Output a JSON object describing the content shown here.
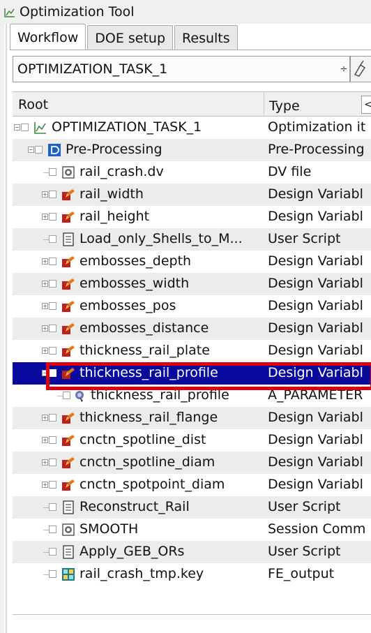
{
  "window": {
    "title": "Optimization Tool",
    "icon": "optimization-app-icon"
  },
  "tabs": [
    {
      "label": "Workflow",
      "active": true
    },
    {
      "label": "DOE setup",
      "active": false
    },
    {
      "label": "Results",
      "active": false
    }
  ],
  "task_select": {
    "value": "OPTIMIZATION_TASK_1",
    "spinner": "÷",
    "tool_icon": "brush-icon"
  },
  "columns": {
    "root": "Root",
    "type": "Type",
    "button": "<"
  },
  "tree": [
    {
      "name": "OPTIMIZATION_TASK_1",
      "type": "Optimization it",
      "icon": "optimization-task-icon",
      "level": 0
    },
    {
      "name": "Pre-Processing",
      "type": "Pre-Processing",
      "icon": "preprocessing-icon",
      "level": 1
    },
    {
      "name": "rail_crash.dv",
      "type": "DV file",
      "icon": "dv-file-icon",
      "level": 2
    },
    {
      "name": "rail_width",
      "type": "Design Variabl",
      "icon": "design-variable-icon",
      "level": 2
    },
    {
      "name": "rail_height",
      "type": "Design Variabl",
      "icon": "design-variable-icon",
      "level": 2
    },
    {
      "name": "Load_only_Shells_to_M...",
      "type": "User Script",
      "icon": "user-script-icon",
      "level": 2
    },
    {
      "name": "embosses_depth",
      "type": "Design Variabl",
      "icon": "design-variable-icon",
      "level": 2
    },
    {
      "name": "embosses_width",
      "type": "Design Variabl",
      "icon": "design-variable-icon",
      "level": 2
    },
    {
      "name": "embosses_pos",
      "type": "Design Variabl",
      "icon": "design-variable-icon",
      "level": 2
    },
    {
      "name": "embosses_distance",
      "type": "Design Variabl",
      "icon": "design-variable-icon",
      "level": 2
    },
    {
      "name": "thickness_rail_plate",
      "type": "Design Variabl",
      "icon": "design-variable-icon",
      "level": 2
    },
    {
      "name": "thickness_rail_profile",
      "type": "Design Variabl",
      "icon": "design-variable-icon",
      "level": 2,
      "selected": true
    },
    {
      "name": "thickness_rail_profile",
      "type": "A_PARAMETER",
      "icon": "parameter-icon",
      "level": 3,
      "highlighted": true
    },
    {
      "name": "thickness_rail_flange",
      "type": "Design Variabl",
      "icon": "design-variable-icon",
      "level": 2
    },
    {
      "name": "cnctn_spotline_dist",
      "type": "Design Variabl",
      "icon": "design-variable-icon",
      "level": 2
    },
    {
      "name": "cnctn_spotline_diam",
      "type": "Design Variabl",
      "icon": "design-variable-icon",
      "level": 2
    },
    {
      "name": "cnctn_spotpoint_diam",
      "type": "Design Variabl",
      "icon": "design-variable-icon",
      "level": 2
    },
    {
      "name": "Reconstruct_Rail",
      "type": "User Script",
      "icon": "user-script-icon",
      "level": 2
    },
    {
      "name": "SMOOTH",
      "type": "Session Comm",
      "icon": "session-command-icon",
      "level": 2
    },
    {
      "name": "Apply_GEB_ORs",
      "type": "User Script",
      "icon": "user-script-icon",
      "level": 2
    },
    {
      "name": "rail_crash_tmp.key",
      "type": "FE_output",
      "icon": "fe-output-icon",
      "level": 2
    }
  ],
  "colors": {
    "selection": "#0a0a9e",
    "highlight_border": "#e0000b",
    "design_variable_orange": "#e07a10",
    "design_variable_red": "#c0201a",
    "preprocessing_blue": "#2060c8",
    "fe_output_teal": "#1a7a8a"
  }
}
